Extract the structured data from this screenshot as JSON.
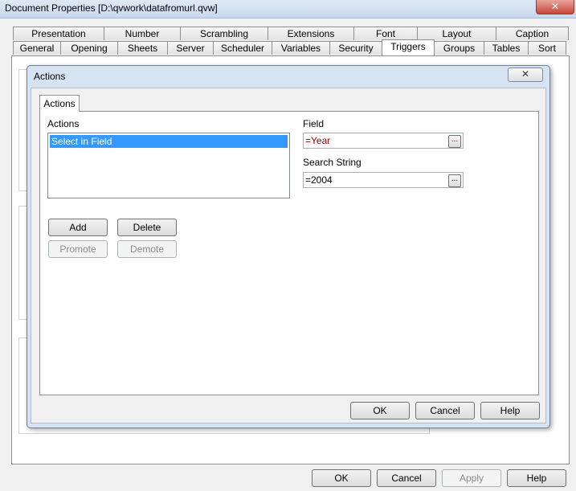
{
  "window": {
    "title": "Document Properties [D:\\qvwork\\datafromurl.qvw]",
    "close_label": "✕"
  },
  "tabs_row1": [
    "Presentation",
    "Number",
    "Scrambling",
    "Extensions",
    "Font",
    "Layout",
    "Caption"
  ],
  "tabs_row2": [
    "General",
    "Opening",
    "Sheets",
    "Server",
    "Scheduler",
    "Variables",
    "Security",
    "Triggers",
    "Groups",
    "Tables",
    "Sort"
  ],
  "active_tab": "Triggers",
  "bottom_buttons": {
    "ok": "OK",
    "cancel": "Cancel",
    "apply": "Apply",
    "help": "Help"
  },
  "actions_dialog": {
    "title": "Actions",
    "close_label": "✕",
    "tab_label": "Actions",
    "actions_label": "Actions",
    "actions_list": [
      "Select in Field"
    ],
    "selected_action": "Select in Field",
    "field_label": "Field",
    "field_value": "=Year",
    "search_string_label": "Search String",
    "search_string_value": "=2004",
    "ellipsis_label": "...",
    "add_label": "Add",
    "delete_label": "Delete",
    "promote_label": "Promote",
    "demote_label": "Demote",
    "ok_label": "OK",
    "cancel_label": "Cancel",
    "help_label": "Help"
  },
  "colors": {
    "selection": "#3399ff",
    "expression_text": "#8b0000",
    "dialog_frame": "#d6e3f3"
  }
}
